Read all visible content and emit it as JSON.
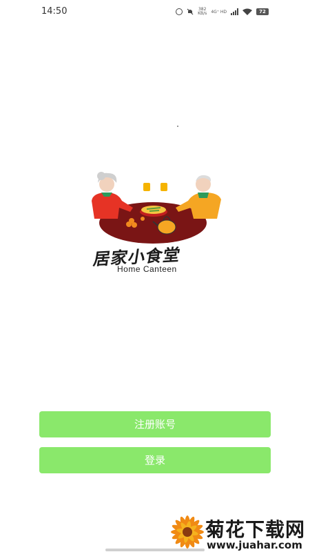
{
  "status_bar": {
    "time": "14:50",
    "net_speed_value": "382",
    "net_speed_unit": "KB/s",
    "network_type": "4G⁺ HD",
    "battery": "72"
  },
  "logo": {
    "title_cn": "居家小食堂",
    "title_en": "Home Canteen"
  },
  "buttons": {
    "register_label": "注册账号",
    "login_label": "登录",
    "color": "#8ae86b"
  },
  "watermark": {
    "title": "菊花下载网",
    "url": "www.juahar.com"
  }
}
